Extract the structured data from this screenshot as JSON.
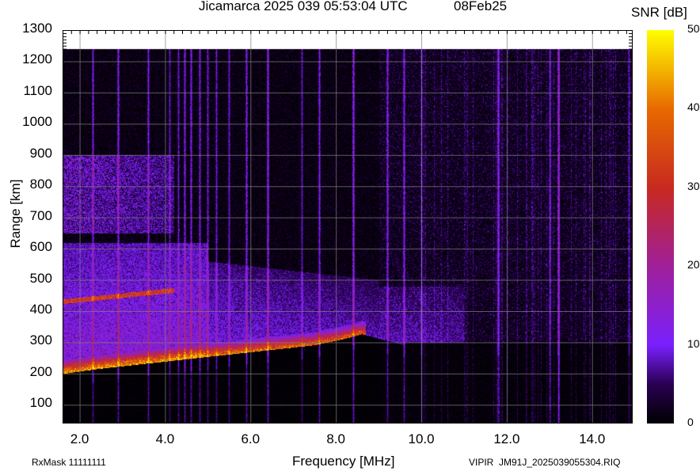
{
  "header": {
    "title": "Jicamarca 2025 039 05:53:04 UTC",
    "date": "08Feb25"
  },
  "footer": {
    "rxmask": "RxMask 11111111",
    "filename": "VIPIR  JM91J_2025039055304.RIQ"
  },
  "colorbar": {
    "title": "SNR [dB]",
    "ticks": [
      "0",
      "10",
      "20",
      "30",
      "40",
      "50"
    ],
    "range": [
      0,
      50
    ],
    "colors": [
      "#000000",
      "#2a0052",
      "#7a20ff",
      "#a0209a",
      "#c82a20",
      "#e86a00",
      "#ffff00"
    ]
  },
  "chart_data": {
    "type": "heatmap",
    "title": "Jicamarca 2025 039 05:53:04 UTC  08Feb25",
    "xlabel": "Frequency [MHz]",
    "ylabel": "Range [km]",
    "xlim": [
      1.6,
      14.95
    ],
    "ylim": [
      40,
      1300
    ],
    "data_max_range_km": 1240,
    "xticks": [
      "2.0",
      "4.0",
      "6.0",
      "8.0",
      "10.0",
      "12.0",
      "14.0"
    ],
    "xtick_values": [
      2,
      4,
      6,
      8,
      10,
      12,
      14
    ],
    "yticks": [
      "100",
      "200",
      "300",
      "400",
      "500",
      "600",
      "700",
      "800",
      "900",
      "1000",
      "1100",
      "1200",
      "1300"
    ],
    "ytick_values": [
      100,
      200,
      300,
      400,
      500,
      600,
      700,
      800,
      900,
      1000,
      1100,
      1200,
      1300
    ],
    "grid": true,
    "value_label": "SNR [dB]",
    "f_trace": {
      "freq_mhz": [
        1.7,
        2.5,
        3.5,
        4.5,
        5.5,
        6.5,
        7.5,
        8.2,
        8.6
      ],
      "virtual_height_km": [
        210,
        225,
        240,
        255,
        270,
        285,
        300,
        320,
        335
      ],
      "peak_snr_db": 42
    },
    "second_hop": {
      "freq_mhz": [
        1.7,
        2.5,
        3.5
      ],
      "virtual_height_km": [
        425,
        440,
        460
      ],
      "peak_snr_db": 30
    },
    "spread_f_region": {
      "freq_mhz": [
        1.6,
        11.0
      ],
      "range_km": [
        250,
        600
      ],
      "snr_db": 15
    },
    "interference_lines_mhz": [
      2.3,
      2.9,
      3.6,
      4.1,
      4.3,
      4.45,
      4.6,
      4.8,
      5.0,
      5.2,
      5.5,
      5.9,
      6.4,
      7.2,
      7.6,
      8.4,
      9.2,
      9.6,
      10.0,
      11.8,
      13.0,
      13.2,
      14.85
    ]
  }
}
